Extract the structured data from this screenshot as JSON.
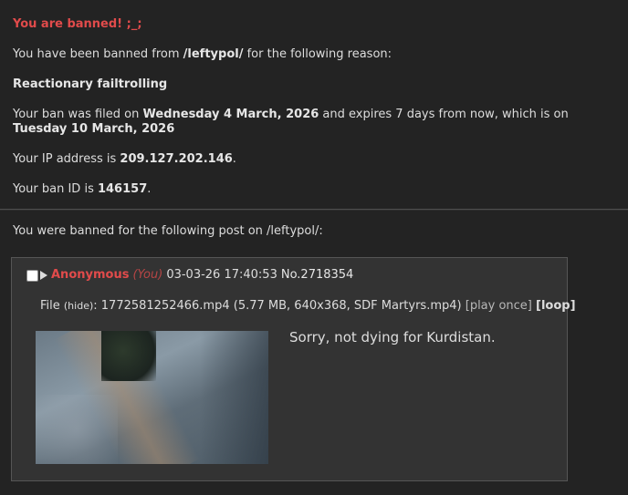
{
  "ban": {
    "title": "You are banned! ;_;",
    "line1_prefix": "You have been banned from ",
    "board": "/leftypol/",
    "line1_suffix": " for the following reason:",
    "reason": "Reactionary failtrolling",
    "filed_prefix": "Your ban was filed on ",
    "filed_date": "Wednesday 4 March, 2026",
    "filed_middle": " and expires 7 days from now, which is on ",
    "expires_date": "Tuesday 10 March, 2026",
    "ip_prefix": "Your IP address is ",
    "ip": "209.127.202.146",
    "ip_suffix": ".",
    "id_prefix": "Your ban ID is ",
    "ban_id": "146157",
    "id_suffix": "."
  },
  "post_intro": "You were banned for the following post on /leftypol/:",
  "post": {
    "name": "Anonymous",
    "you": "(You)",
    "datetime": "03-03-26 17:40:53",
    "number": "No.2718354",
    "file_label": "File ",
    "hide_label": "(hide)",
    "file_colon": ": ",
    "filename": "1772581252466.mp4",
    "file_meta_prefix": " (5.77 MB, 640x368, ",
    "original_name": "SDF Martyrs.mp4",
    "file_meta_suffix": ")",
    "play_once": " [play once] ",
    "loop": "[loop]",
    "message": "Sorry, not dying for Kurdistan."
  },
  "icons": {
    "checkbox": "checkbox-icon",
    "expand": "triangle-right-icon"
  },
  "colors": {
    "background": "#232323",
    "post_background": "#333333",
    "accent_red": "#e14b4b",
    "text": "#dddddd"
  }
}
